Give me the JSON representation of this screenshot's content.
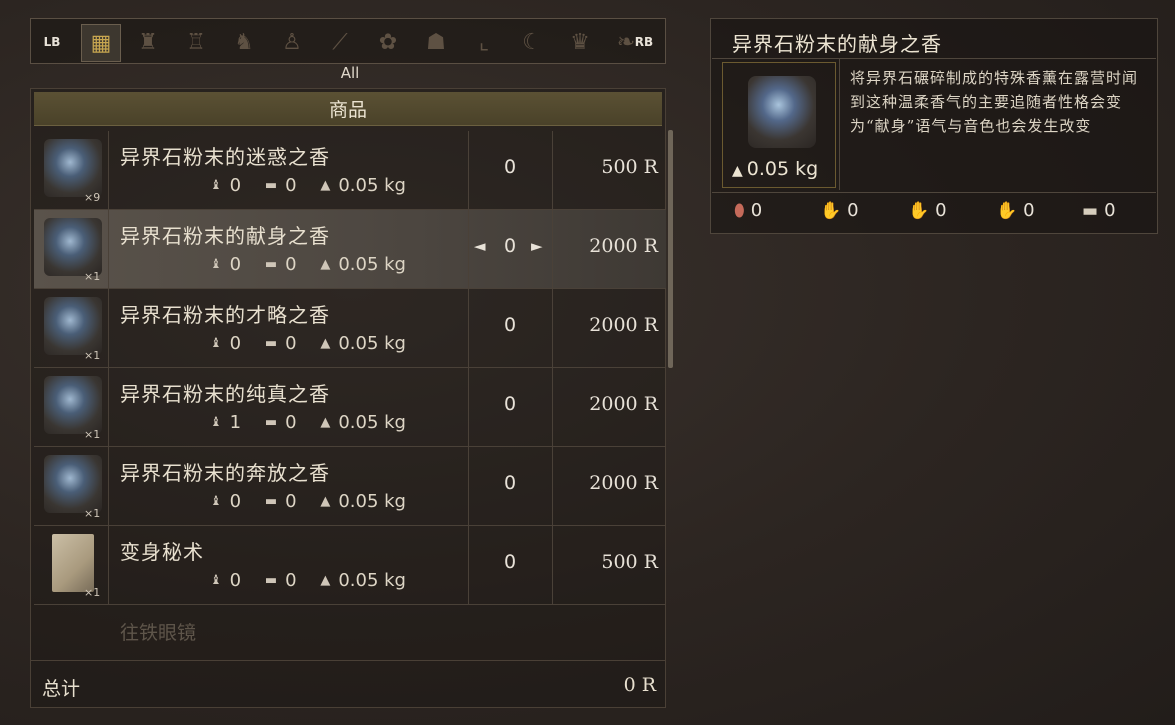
{
  "tabs": {
    "lb": "LB",
    "rb": "RB",
    "active_label": "All",
    "icons": [
      "all-items-icon",
      "potion-icon",
      "helmet-icon",
      "armor-icon",
      "ring-icon",
      "sword-icon",
      "herb-icon",
      "cape-icon",
      "boots-icon",
      "bow-icon",
      "hood-icon",
      "horn-icon"
    ]
  },
  "list": {
    "section_header": "商品",
    "rows": [
      {
        "name": "异界石粉末的迷惑之香",
        "qty": "×9",
        "stat1": "0",
        "stat2": "0",
        "weight": "0.05 kg",
        "count": "0",
        "price": "500 R",
        "icon": "incense-icon",
        "selected": false
      },
      {
        "name": "异界石粉末的献身之香",
        "qty": "×1",
        "stat1": "0",
        "stat2": "0",
        "weight": "0.05 kg",
        "count": "0",
        "price": "2000 R",
        "icon": "incense-icon",
        "selected": true
      },
      {
        "name": "异界石粉末的才略之香",
        "qty": "×1",
        "stat1": "0",
        "stat2": "0",
        "weight": "0.05 kg",
        "count": "0",
        "price": "2000 R",
        "icon": "incense-icon",
        "selected": false
      },
      {
        "name": "异界石粉末的纯真之香",
        "qty": "×1",
        "stat1": "1",
        "stat2": "0",
        "weight": "0.05 kg",
        "count": "0",
        "price": "2000 R",
        "icon": "incense-icon",
        "selected": false
      },
      {
        "name": "异界石粉末的奔放之香",
        "qty": "×1",
        "stat1": "0",
        "stat2": "0",
        "weight": "0.05 kg",
        "count": "0",
        "price": "2000 R",
        "icon": "incense-icon",
        "selected": false
      },
      {
        "name": "变身秘术",
        "qty": "×1",
        "stat1": "0",
        "stat2": "0",
        "weight": "0.05 kg",
        "count": "0",
        "price": "500 R",
        "icon": "scroll-icon",
        "selected": false
      }
    ],
    "faded_next": "往铁眼镜"
  },
  "total": {
    "label": "总计",
    "value": "0 R"
  },
  "detail": {
    "title": "异界石粉末的献身之香",
    "weight": "0.05 kg",
    "description": "将异界石碾碎制成的特殊香薰在露营时闻到这种温柔香气的主要追随者性格会变为“献身”语气与音色也会发生改变",
    "stats": [
      {
        "icon": "shield-icon",
        "value": "0",
        "color": "#c56a5a"
      },
      {
        "icon": "blue-hand-icon",
        "value": "0",
        "color": "#5f7fc9"
      },
      {
        "icon": "hand-icon",
        "value": "0",
        "color": "#c9b190"
      },
      {
        "icon": "open-hand-icon",
        "value": "0",
        "color": "#c9b190"
      },
      {
        "icon": "chest-icon",
        "value": "0",
        "color": "#d6cdbd"
      }
    ]
  }
}
